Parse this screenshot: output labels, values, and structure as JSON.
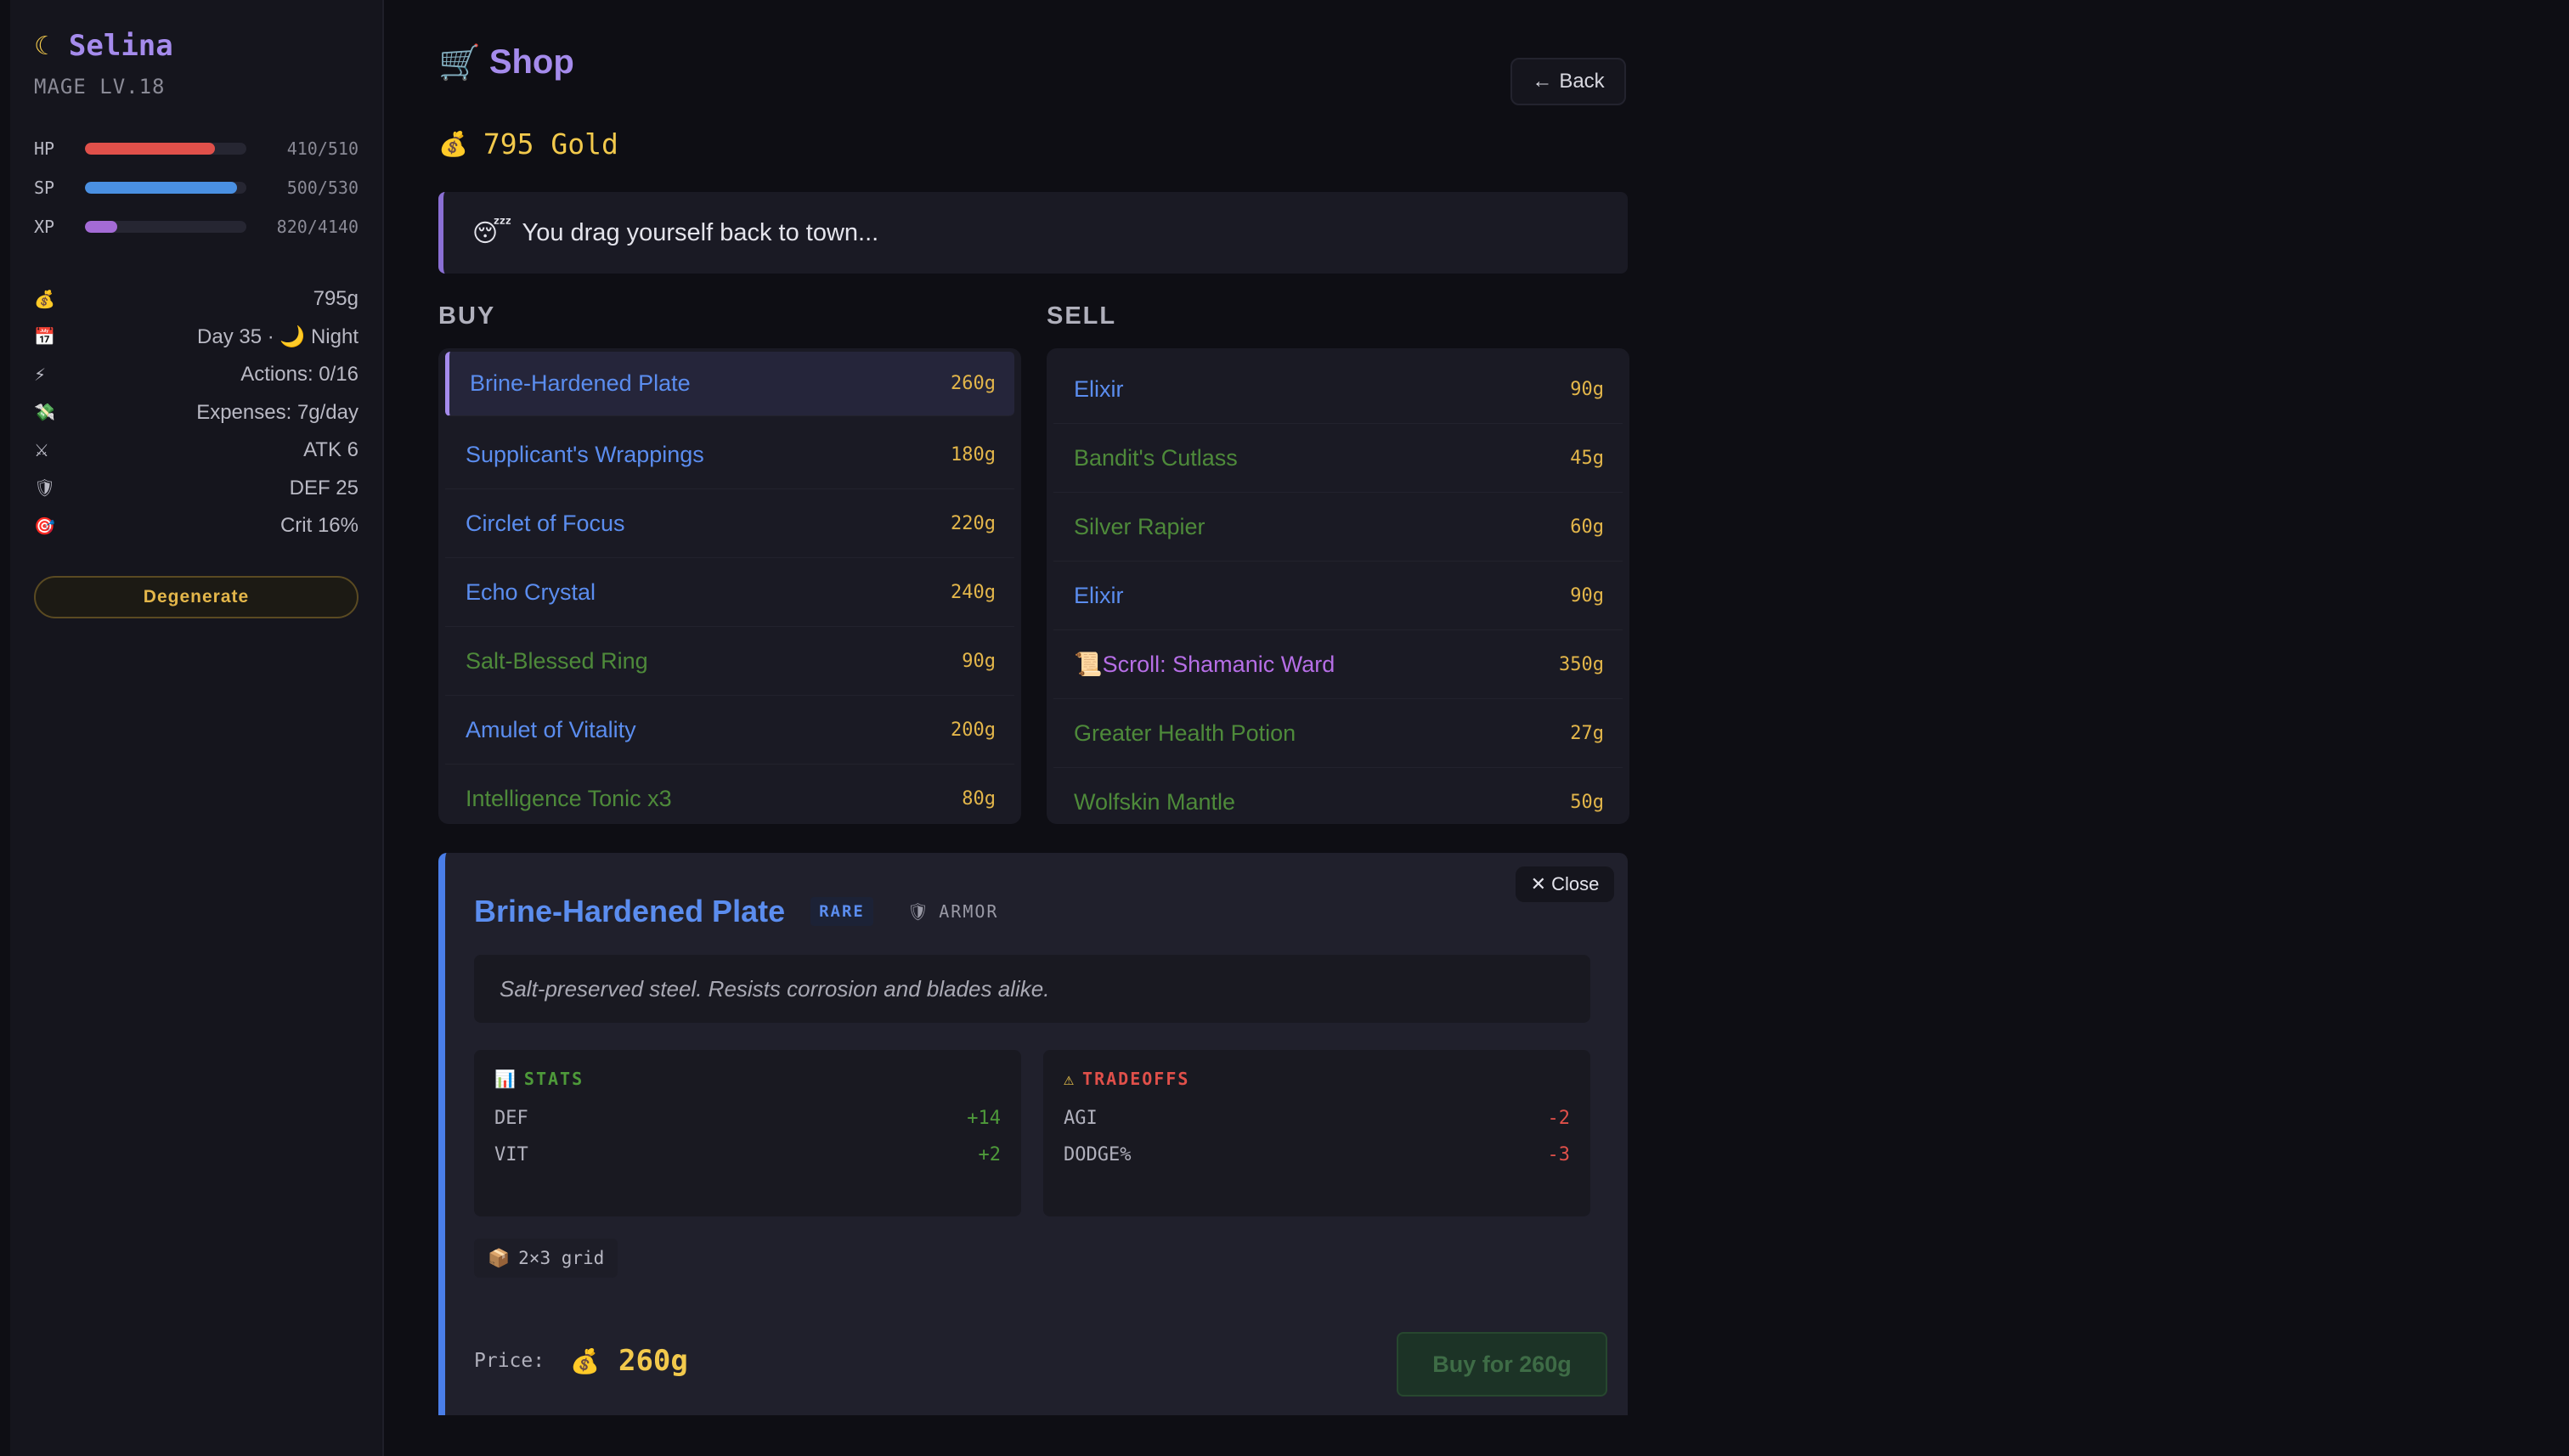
{
  "character": {
    "name": "Selina",
    "class_level": "MAGE LV.18",
    "bars": [
      {
        "label": "HP",
        "value": "410/510",
        "fraction": 0.804,
        "color": "#e0504a"
      },
      {
        "label": "SP",
        "value": "500/530",
        "fraction": 0.943,
        "color": "#4a90e2"
      },
      {
        "label": "XP",
        "value": "820/4140",
        "fraction": 0.198,
        "color": "#a46bd6"
      }
    ],
    "stats": [
      {
        "icon": "money-bag-icon",
        "glyph": "💰",
        "value": "795g"
      },
      {
        "icon": "calendar-icon",
        "glyph": "📅",
        "value": "Day 35 · 🌙 Night"
      },
      {
        "icon": "lightning-icon",
        "glyph": "⚡",
        "value": "Actions: 0/16"
      },
      {
        "icon": "money-wings-icon",
        "glyph": "💸",
        "value": "Expenses: 7g/day"
      },
      {
        "icon": "crossed-swords-icon",
        "glyph": "⚔",
        "value": "ATK 6"
      },
      {
        "icon": "shield-icon",
        "glyph": "🛡",
        "value": "DEF 25"
      },
      {
        "icon": "target-icon",
        "glyph": "🎯",
        "value": "Crit 16%"
      }
    ],
    "degenerate_label": "Degenerate"
  },
  "shop": {
    "title": "Shop",
    "back_label": "Back",
    "gold": "795 Gold",
    "message": "You drag yourself back to town...",
    "buy_heading": "BUY",
    "sell_heading": "SELL",
    "buy_items": [
      {
        "name": "Brine-Hardened Plate",
        "price": "260g",
        "color": "blue",
        "selected": true
      },
      {
        "name": "Supplicant's Wrappings",
        "price": "180g",
        "color": "blue"
      },
      {
        "name": "Circlet of Focus",
        "price": "220g",
        "color": "blue"
      },
      {
        "name": "Echo Crystal",
        "price": "240g",
        "color": "blue"
      },
      {
        "name": "Salt-Blessed Ring",
        "price": "90g",
        "color": "green"
      },
      {
        "name": "Amulet of Vitality",
        "price": "200g",
        "color": "blue"
      },
      {
        "name": "Intelligence Tonic x3",
        "price": "80g",
        "color": "green"
      }
    ],
    "sell_items": [
      {
        "name": "Elixir",
        "price": "90g",
        "color": "blue"
      },
      {
        "name": "Bandit's Cutlass",
        "price": "45g",
        "color": "green"
      },
      {
        "name": "Silver Rapier",
        "price": "60g",
        "color": "green"
      },
      {
        "name": "Elixir",
        "price": "90g",
        "color": "blue"
      },
      {
        "name": "Scroll: Shamanic Ward",
        "price": "350g",
        "color": "purple",
        "icon": "scroll-icon"
      },
      {
        "name": "Greater Health Potion",
        "price": "27g",
        "color": "green"
      },
      {
        "name": "Wolfskin Mantle",
        "price": "50g",
        "color": "green"
      }
    ]
  },
  "detail": {
    "close_label": "Close",
    "name": "Brine-Hardened Plate",
    "rarity": "RARE",
    "slot": "ARMOR",
    "description": "Salt-preserved steel. Resists corrosion and blades alike.",
    "stats_heading": "STATS",
    "stats": [
      {
        "label": "DEF",
        "value": "+14"
      },
      {
        "label": "VIT",
        "value": "+2"
      }
    ],
    "tradeoffs_heading": "TRADEOFFS",
    "tradeoffs": [
      {
        "label": "AGI",
        "value": "-2"
      },
      {
        "label": "DODGE%",
        "value": "-3"
      }
    ],
    "grid_size": "2×3 grid",
    "price_label": "Price:",
    "price_value": "260g",
    "buy_label": "Buy for 260g"
  }
}
